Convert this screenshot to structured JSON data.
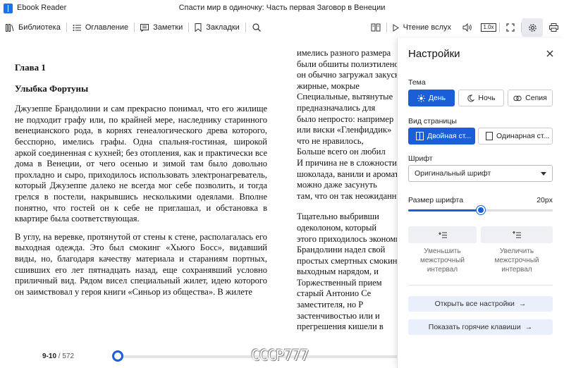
{
  "window": {
    "app_title": "Ebook Reader",
    "doc_title": "Спасти мир в одиночку: Часть первая Заговор в Венеции"
  },
  "toolbar": {
    "library": "Библиотека",
    "contents": "Оглавление",
    "notes": "Заметки",
    "bookmarks": "Закладки",
    "read_aloud": "Чтение вслух",
    "speed": "1.0x"
  },
  "book": {
    "chapter": "Глава 1",
    "subtitle": "Улыбка Фортуны",
    "paragraphs": [
      "Джузеппе Брандолини и сам прекрасно понимал, что его жилище не подходит графу или, по крайней мере, наследнику старинного венецианского рода, в корнях генеалогического древа которого, бесспорно, имелись графы. Одна спальня-гостиная, широкой аркой соединенная с кухней; без отопления, как и практически все дома в Венеции, от чего осенью и зимой там было довольно прохладно и сыро, приходилось использовать электронагреватель, который Джузеппе далеко не всегда мог себе позволить, и тогда грелся в постели, накрывшись несколькими одеялами. Вполне понятно, что гостей он к себе не приглашал, и обстановка в квартире была соответствующая.",
      "В углу, на веревке, протянутой от стены к стене, располагалась его выходная одежда. Это был смокинг «Хьюго Босс», видавший виды, но, благодаря качеству материала и стараниям портных, сшивших его лет пятнадцать назад, еще сохранявший условно приличный вид. Рядом висел специальный жилет, идею которого он заимствовал у героя книги «Синьор из общества». В жилете"
    ],
    "right_col_1": [
      "имелись разного размера",
      "были обшиты полиэтиленом",
      "он обычно загружал закуски",
      "жирные, мокрые",
      "Специальные, вытянутые",
      "предназначались для",
      "было непросто: например",
      "или виски «Гленфиддик»",
      "что не нравилось,",
      "Больше всего он любил",
      "И причина не в сложности",
      "шоколада, ванили и аромата",
      "можно даже засунуть",
      "там, что он так неожиданно"
    ],
    "right_col_2": [
      "Тщательно выбривши",
      "одеколоном, который",
      "этого приходилось экономить",
      "Брандолини надел свой",
      "простых смертных смокинг",
      "выходным нарядом, и",
      "Торжественный прием",
      "старый Антонио Се",
      "заместителя, но Р",
      "застенчивостью или и",
      "прегрешения кишели в"
    ]
  },
  "footer": {
    "current_pages": "9-10",
    "separator": "/",
    "total_pages": "572",
    "progress_fraction": 0.016,
    "watermark": "CCCP777"
  },
  "settings": {
    "title": "Настройки",
    "theme_label": "Тема",
    "themes": [
      "День",
      "Ночь",
      "Сепия"
    ],
    "theme_selected": "День",
    "view_label": "Вид страницы",
    "views": [
      "Двойная ст...",
      "Одинарная ст..."
    ],
    "view_selected": "Двойная ст...",
    "font_label": "Шрифт",
    "font_value": "Оригинальный шрифт",
    "font_size_label": "Размер шрифта",
    "font_size_value": "20px",
    "font_size_fraction": 0.5,
    "decrease_spacing": [
      "Уменьшить",
      "межстрочный",
      "интервал"
    ],
    "increase_spacing": [
      "Увеличить",
      "межстрочный",
      "интервал"
    ],
    "open_all_settings": "Открыть все настройки",
    "show_hotkeys": "Показать горячие клавиши",
    "accent_color": "#1a5fd8"
  }
}
